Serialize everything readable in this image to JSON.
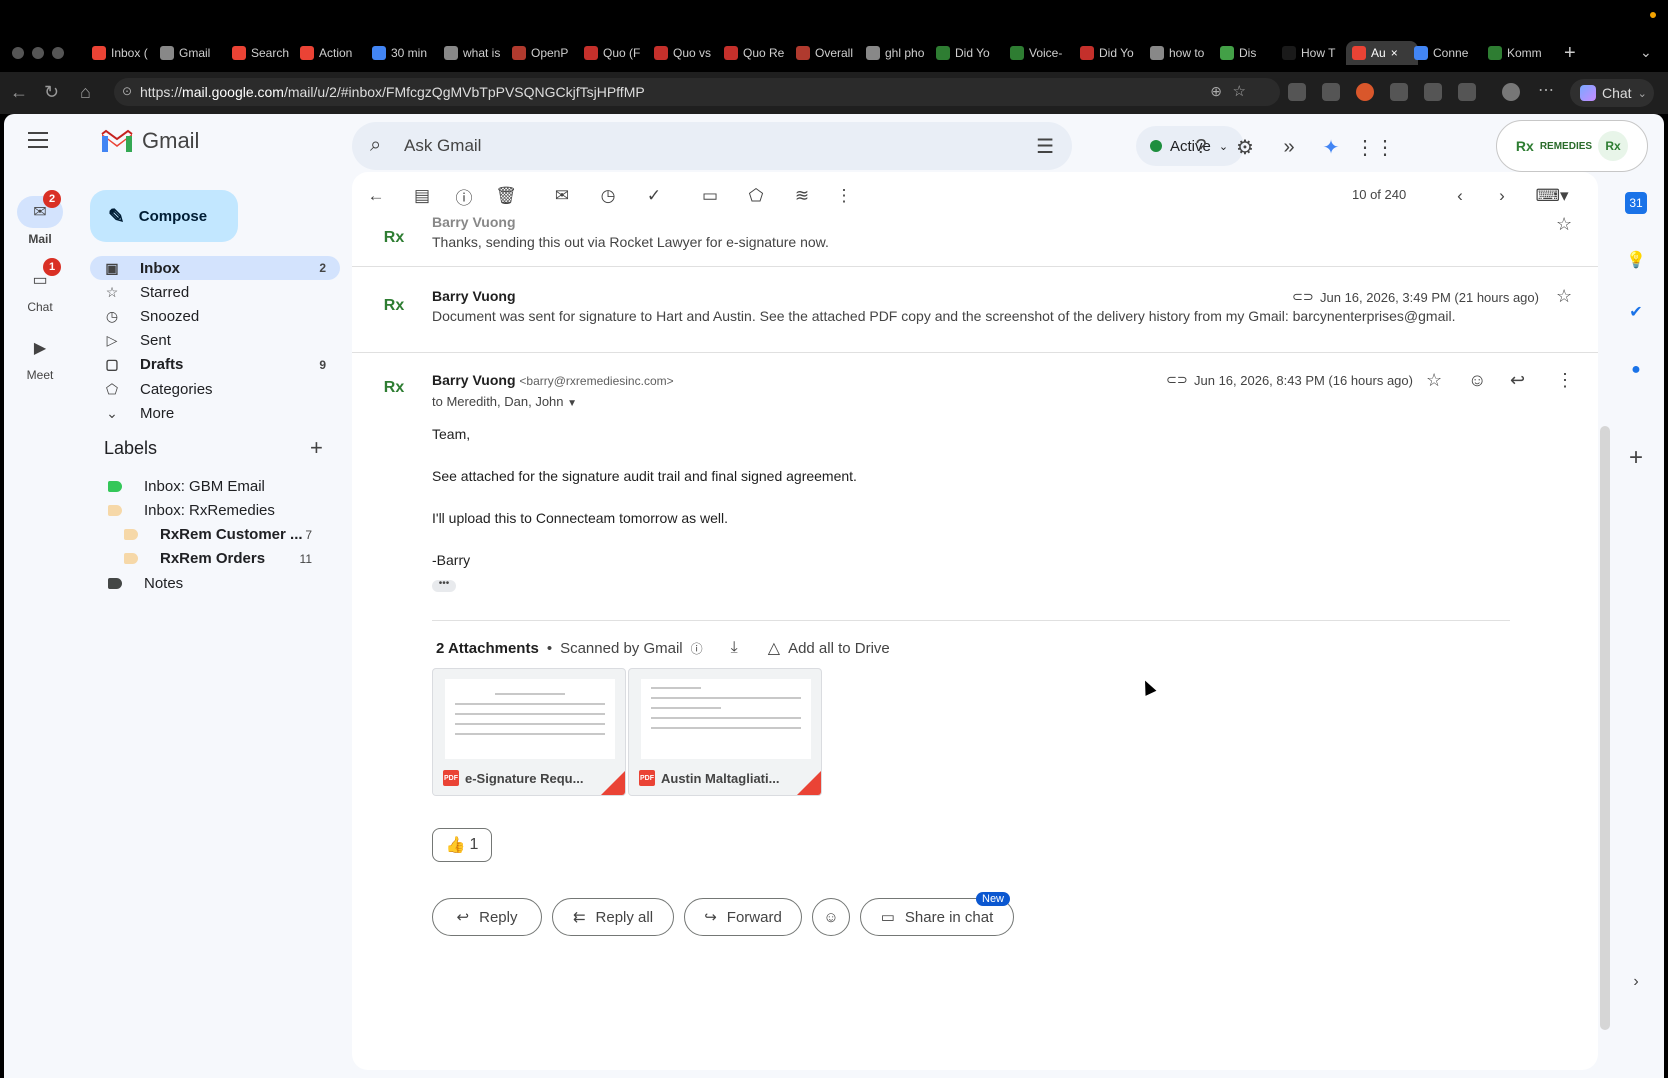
{
  "browser": {
    "tabs": [
      {
        "label": "Inbox (",
        "icon": "gmail-icon",
        "color": "#ea4335"
      },
      {
        "label": "Gmail",
        "icon": "google-icon",
        "color": "#888888"
      },
      {
        "label": "Search",
        "icon": "gmail-icon",
        "color": "#ea4335"
      },
      {
        "label": "Action",
        "icon": "gmail-icon",
        "color": "#ea4335"
      },
      {
        "label": "30 min",
        "icon": "calendar-icon",
        "color": "#4285f4"
      },
      {
        "label": "what is",
        "icon": "google-icon",
        "color": "#888888"
      },
      {
        "label": "OpenP",
        "icon": "openphone-icon",
        "color": "#b03a2e"
      },
      {
        "label": "Quo (F",
        "icon": "youtube-icon",
        "color": "#c4302b"
      },
      {
        "label": "Quo vs",
        "icon": "youtube-icon",
        "color": "#c4302b"
      },
      {
        "label": "Quo Re",
        "icon": "youtube-icon",
        "color": "#c4302b"
      },
      {
        "label": "Overall",
        "icon": "openphone-icon",
        "color": "#b03a2e"
      },
      {
        "label": "ghl pho",
        "icon": "google-icon",
        "color": "#888888"
      },
      {
        "label": "Did Yo",
        "icon": "voice-icon",
        "color": "#2e7d32"
      },
      {
        "label": "Voice-",
        "icon": "voice-icon",
        "color": "#2e7d32"
      },
      {
        "label": "Did Yo",
        "icon": "youtube-icon",
        "color": "#c4302b"
      },
      {
        "label": "how to",
        "icon": "google-icon",
        "color": "#888888"
      },
      {
        "label": "Dis",
        "icon": "leaf-icon",
        "color": "#43a047"
      },
      {
        "label": "How T",
        "icon": "blank-icon",
        "color": "#1a1a1a"
      },
      {
        "label": "Au",
        "icon": "gmail-icon",
        "color": "#ea4335",
        "active": true
      },
      {
        "label": "Conne",
        "icon": "connecteam-icon",
        "color": "#4285f4"
      },
      {
        "label": "Komm",
        "icon": "komm-icon",
        "color": "#2e7d32"
      }
    ],
    "url_prefix": "https://",
    "url_host": "mail.google.com",
    "url_path": "/mail/u/2/#inbox/FMfcgzQgMVbTpPVSQNGCkjfTsjHPffMP",
    "chat_label": "Chat"
  },
  "rail": {
    "mail": {
      "label": "Mail",
      "badge": "2"
    },
    "chat": {
      "label": "Chat",
      "badge": "1"
    },
    "meet": {
      "label": "Meet"
    }
  },
  "app": {
    "name": "Gmail"
  },
  "compose_label": "Compose",
  "nav": [
    {
      "label": "Inbox",
      "count": "2",
      "icon": "inbox-icon"
    },
    {
      "label": "Starred",
      "count": "",
      "icon": "star-icon"
    },
    {
      "label": "Snoozed",
      "count": "",
      "icon": "clock-icon"
    },
    {
      "label": "Sent",
      "count": "",
      "icon": "send-icon"
    },
    {
      "label": "Drafts",
      "count": "9",
      "icon": "draft-icon"
    },
    {
      "label": "Categories",
      "count": "",
      "icon": "label-icon"
    },
    {
      "label": "More",
      "count": "",
      "icon": "chevron-down-icon"
    }
  ],
  "labels": {
    "title": "Labels",
    "items": [
      {
        "label": "Inbox: GBM Email",
        "count": "",
        "color": "#34c759"
      },
      {
        "label": "Inbox: RxRemedies",
        "count": "",
        "color": "#f6d8a8"
      },
      {
        "label": "RxRem Customer ...",
        "count": "7",
        "color": "#f6d8a8"
      },
      {
        "label": "RxRem Orders",
        "count": "11",
        "color": "#f6d8a8"
      },
      {
        "label": "Notes",
        "count": "",
        "color": "#444746"
      }
    ]
  },
  "search": {
    "placeholder": "Ask Gmail"
  },
  "status": {
    "label": "Active",
    "color": "#1e8e3e"
  },
  "account": {
    "brand": "REMEDIES"
  },
  "pager": "10 of 240",
  "messages": [
    {
      "sender": "Barry Vuong",
      "snippet": "Thanks, sending this out via Rocket Lawyer for e-signature now."
    },
    {
      "sender": "Barry Vuong",
      "snippet": "Document was sent for signature to Hart and Austin. See the attached PDF copy and the screenshot of the delivery history from my Gmail: barcynenterprises@gmail.",
      "date": "Jun 16, 2026, 3:49 PM (21 hours ago)"
    }
  ],
  "open_message": {
    "sender": "Barry Vuong",
    "email": "<barry@rxremediesinc.com>",
    "to": "to Meredith, Dan, John",
    "date": "Jun 16, 2026, 8:43 PM (16 hours ago)",
    "body": [
      "Team,",
      "See attached for the signature audit trail and final signed agreement.",
      "I'll upload this to Connecteam tomorrow as well.",
      "-Barry"
    ],
    "attachments_title": "2 Attachments",
    "scanned": "Scanned by Gmail",
    "add_to_drive": "Add all to Drive",
    "attachments": [
      {
        "name": "e-Signature Requ...",
        "type": "PDF"
      },
      {
        "name": "Austin Maltagliati...",
        "type": "PDF"
      }
    ],
    "reaction": {
      "emoji": "👍",
      "count": "1"
    }
  },
  "actions": {
    "reply": "Reply",
    "reply_all": "Reply all",
    "forward": "Forward",
    "share": "Share in chat",
    "new_badge": "New"
  },
  "side_panel": {
    "calendar_day": "31"
  }
}
